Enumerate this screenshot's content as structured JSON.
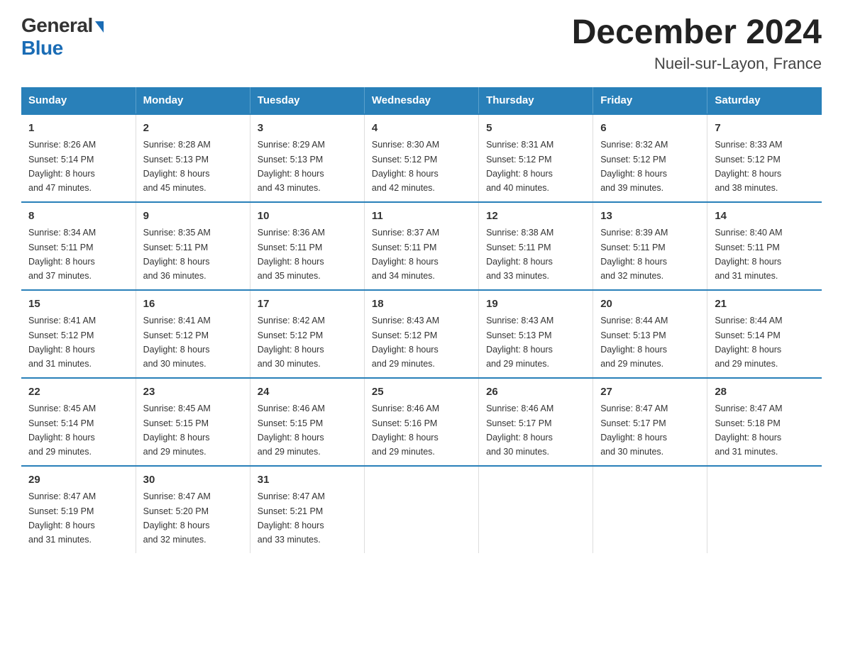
{
  "logo": {
    "general": "General",
    "blue": "Blue"
  },
  "title": "December 2024",
  "location": "Nueil-sur-Layon, France",
  "days_of_week": [
    "Sunday",
    "Monday",
    "Tuesday",
    "Wednesday",
    "Thursday",
    "Friday",
    "Saturday"
  ],
  "weeks": [
    [
      {
        "day": "1",
        "sunrise": "8:26 AM",
        "sunset": "5:14 PM",
        "daylight": "8 hours and 47 minutes."
      },
      {
        "day": "2",
        "sunrise": "8:28 AM",
        "sunset": "5:13 PM",
        "daylight": "8 hours and 45 minutes."
      },
      {
        "day": "3",
        "sunrise": "8:29 AM",
        "sunset": "5:13 PM",
        "daylight": "8 hours and 43 minutes."
      },
      {
        "day": "4",
        "sunrise": "8:30 AM",
        "sunset": "5:12 PM",
        "daylight": "8 hours and 42 minutes."
      },
      {
        "day": "5",
        "sunrise": "8:31 AM",
        "sunset": "5:12 PM",
        "daylight": "8 hours and 40 minutes."
      },
      {
        "day": "6",
        "sunrise": "8:32 AM",
        "sunset": "5:12 PM",
        "daylight": "8 hours and 39 minutes."
      },
      {
        "day": "7",
        "sunrise": "8:33 AM",
        "sunset": "5:12 PM",
        "daylight": "8 hours and 38 minutes."
      }
    ],
    [
      {
        "day": "8",
        "sunrise": "8:34 AM",
        "sunset": "5:11 PM",
        "daylight": "8 hours and 37 minutes."
      },
      {
        "day": "9",
        "sunrise": "8:35 AM",
        "sunset": "5:11 PM",
        "daylight": "8 hours and 36 minutes."
      },
      {
        "day": "10",
        "sunrise": "8:36 AM",
        "sunset": "5:11 PM",
        "daylight": "8 hours and 35 minutes."
      },
      {
        "day": "11",
        "sunrise": "8:37 AM",
        "sunset": "5:11 PM",
        "daylight": "8 hours and 34 minutes."
      },
      {
        "day": "12",
        "sunrise": "8:38 AM",
        "sunset": "5:11 PM",
        "daylight": "8 hours and 33 minutes."
      },
      {
        "day": "13",
        "sunrise": "8:39 AM",
        "sunset": "5:11 PM",
        "daylight": "8 hours and 32 minutes."
      },
      {
        "day": "14",
        "sunrise": "8:40 AM",
        "sunset": "5:11 PM",
        "daylight": "8 hours and 31 minutes."
      }
    ],
    [
      {
        "day": "15",
        "sunrise": "8:41 AM",
        "sunset": "5:12 PM",
        "daylight": "8 hours and 31 minutes."
      },
      {
        "day": "16",
        "sunrise": "8:41 AM",
        "sunset": "5:12 PM",
        "daylight": "8 hours and 30 minutes."
      },
      {
        "day": "17",
        "sunrise": "8:42 AM",
        "sunset": "5:12 PM",
        "daylight": "8 hours and 30 minutes."
      },
      {
        "day": "18",
        "sunrise": "8:43 AM",
        "sunset": "5:12 PM",
        "daylight": "8 hours and 29 minutes."
      },
      {
        "day": "19",
        "sunrise": "8:43 AM",
        "sunset": "5:13 PM",
        "daylight": "8 hours and 29 minutes."
      },
      {
        "day": "20",
        "sunrise": "8:44 AM",
        "sunset": "5:13 PM",
        "daylight": "8 hours and 29 minutes."
      },
      {
        "day": "21",
        "sunrise": "8:44 AM",
        "sunset": "5:14 PM",
        "daylight": "8 hours and 29 minutes."
      }
    ],
    [
      {
        "day": "22",
        "sunrise": "8:45 AM",
        "sunset": "5:14 PM",
        "daylight": "8 hours and 29 minutes."
      },
      {
        "day": "23",
        "sunrise": "8:45 AM",
        "sunset": "5:15 PM",
        "daylight": "8 hours and 29 minutes."
      },
      {
        "day": "24",
        "sunrise": "8:46 AM",
        "sunset": "5:15 PM",
        "daylight": "8 hours and 29 minutes."
      },
      {
        "day": "25",
        "sunrise": "8:46 AM",
        "sunset": "5:16 PM",
        "daylight": "8 hours and 29 minutes."
      },
      {
        "day": "26",
        "sunrise": "8:46 AM",
        "sunset": "5:17 PM",
        "daylight": "8 hours and 30 minutes."
      },
      {
        "day": "27",
        "sunrise": "8:47 AM",
        "sunset": "5:17 PM",
        "daylight": "8 hours and 30 minutes."
      },
      {
        "day": "28",
        "sunrise": "8:47 AM",
        "sunset": "5:18 PM",
        "daylight": "8 hours and 31 minutes."
      }
    ],
    [
      {
        "day": "29",
        "sunrise": "8:47 AM",
        "sunset": "5:19 PM",
        "daylight": "8 hours and 31 minutes."
      },
      {
        "day": "30",
        "sunrise": "8:47 AM",
        "sunset": "5:20 PM",
        "daylight": "8 hours and 32 minutes."
      },
      {
        "day": "31",
        "sunrise": "8:47 AM",
        "sunset": "5:21 PM",
        "daylight": "8 hours and 33 minutes."
      },
      null,
      null,
      null,
      null
    ]
  ],
  "labels": {
    "sunrise": "Sunrise:",
    "sunset": "Sunset:",
    "daylight": "Daylight:"
  }
}
